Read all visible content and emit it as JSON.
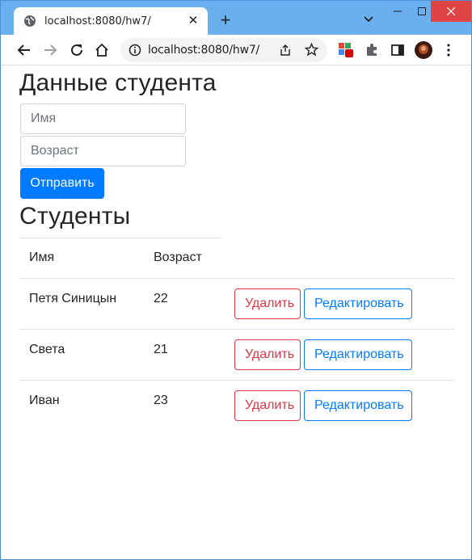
{
  "browser": {
    "tab_title": "localhost:8080/hw7/",
    "url": "localhost:8080/hw7/",
    "icons": [
      "globe-icon",
      "close-icon",
      "plus-icon",
      "chevron-down-icon",
      "minimize-icon",
      "maximize-icon",
      "window-close-icon",
      "back-icon",
      "forward-icon",
      "reload-icon",
      "home-icon",
      "info-icon",
      "share-icon",
      "star-icon",
      "extension-icon",
      "puzzle-icon",
      "sidebar-icon",
      "avatar",
      "menu-icon"
    ]
  },
  "form": {
    "title": "Данные студента",
    "name_placeholder": "Имя",
    "age_placeholder": "Возраст",
    "submit_label": "Отправить"
  },
  "students": {
    "title": "Студенты",
    "headers": [
      "Имя",
      "Возраст",
      ""
    ],
    "rows": [
      {
        "name": "Петя Синицын",
        "age": "22"
      },
      {
        "name": "Света",
        "age": "21"
      },
      {
        "name": "Иван",
        "age": "23"
      }
    ],
    "delete_label": "Удалить",
    "edit_label": "Редактировать"
  },
  "colors": {
    "primary": "#007bff",
    "danger": "#dc3545",
    "titlebar": "#6ab0ee"
  }
}
